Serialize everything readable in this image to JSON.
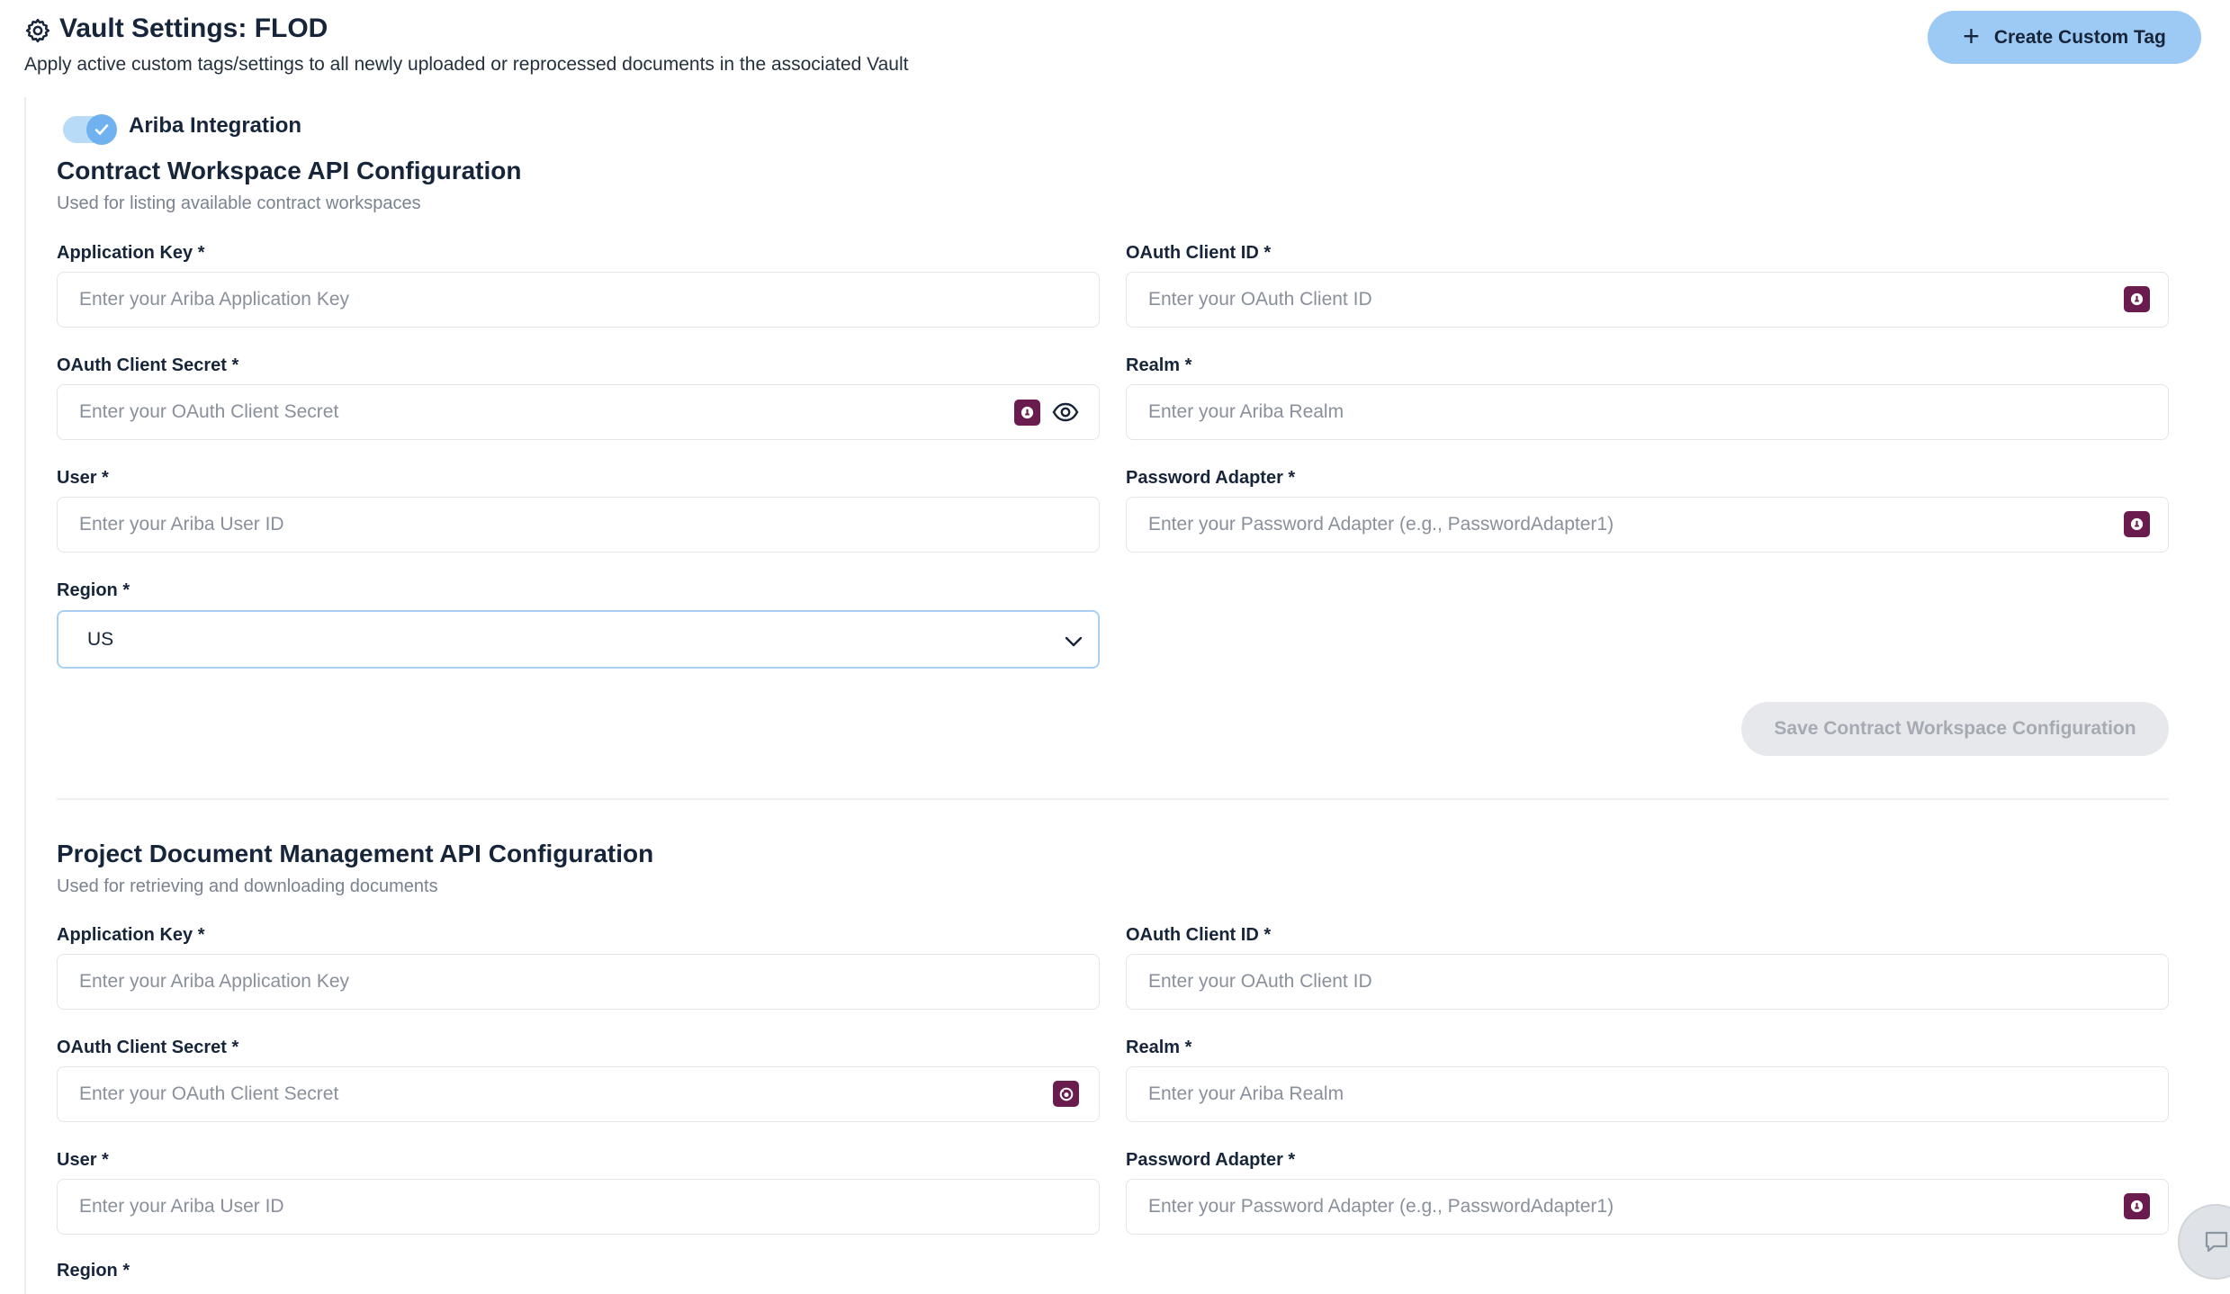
{
  "header": {
    "title": "Vault Settings: FLOD",
    "subtitle": "Apply active custom tags/settings to all newly uploaded or reprocessed documents in the associated Vault",
    "create_button": "Create Custom Tag"
  },
  "integration": {
    "label": "Ariba Integration",
    "enabled": true
  },
  "contract_workspace": {
    "title": "Contract Workspace API Configuration",
    "subtitle": "Used for listing available contract workspaces",
    "application_key": {
      "label": "Application Key *",
      "placeholder": "Enter your Ariba Application Key"
    },
    "oauth_client_id": {
      "label": "OAuth Client ID *",
      "placeholder": "Enter your OAuth Client ID"
    },
    "oauth_client_secret": {
      "label": "OAuth Client Secret *",
      "placeholder": "Enter your OAuth Client Secret"
    },
    "realm": {
      "label": "Realm *",
      "placeholder": "Enter your Ariba Realm"
    },
    "user": {
      "label": "User *",
      "placeholder": "Enter your Ariba User ID"
    },
    "password_adapter": {
      "label": "Password Adapter *",
      "placeholder": "Enter your Password Adapter (e.g., PasswordAdapter1)"
    },
    "region": {
      "label": "Region *",
      "value": "US"
    },
    "save_button": "Save Contract Workspace Configuration"
  },
  "project_document": {
    "title": "Project Document Management API Configuration",
    "subtitle": "Used for retrieving and downloading documents",
    "application_key": {
      "label": "Application Key *",
      "placeholder": "Enter your Ariba Application Key"
    },
    "oauth_client_id": {
      "label": "OAuth Client ID *",
      "placeholder": "Enter your OAuth Client ID"
    },
    "oauth_client_secret": {
      "label": "OAuth Client Secret *",
      "placeholder": "Enter your OAuth Client Secret"
    },
    "realm": {
      "label": "Realm *",
      "placeholder": "Enter your Ariba Realm"
    },
    "user": {
      "label": "User *",
      "placeholder": "Enter your Ariba User ID"
    },
    "password_adapter": {
      "label": "Password Adapter *",
      "placeholder": "Enter your Password Adapter (e.g., PasswordAdapter1)"
    },
    "region": {
      "label": "Region *"
    }
  },
  "colors": {
    "primary_button": "#9dcaf4",
    "toggle_on": "#6fb2ef",
    "secret_badge": "#6b1c4f",
    "text_dark": "#17253a"
  },
  "icons": [
    "gear-icon",
    "plus-icon",
    "check-icon",
    "secret-manager-icon",
    "eye-icon",
    "chevron-down-icon",
    "chat-icon"
  ]
}
